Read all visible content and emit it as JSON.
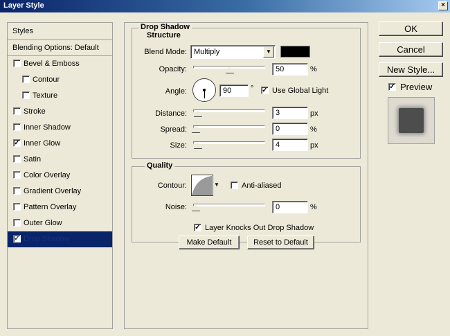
{
  "window": {
    "title": "Layer Style",
    "close_glyph": "×"
  },
  "sidebar": {
    "header": "Styles",
    "blending": "Blending Options: Default",
    "items": [
      {
        "label": "Bevel & Emboss",
        "checked": false,
        "sub": false
      },
      {
        "label": "Contour",
        "checked": false,
        "sub": true
      },
      {
        "label": "Texture",
        "checked": false,
        "sub": true
      },
      {
        "label": "Stroke",
        "checked": false,
        "sub": false
      },
      {
        "label": "Inner Shadow",
        "checked": false,
        "sub": false
      },
      {
        "label": "Inner Glow",
        "checked": true,
        "sub": false
      },
      {
        "label": "Satin",
        "checked": false,
        "sub": false
      },
      {
        "label": "Color Overlay",
        "checked": false,
        "sub": false
      },
      {
        "label": "Gradient Overlay",
        "checked": false,
        "sub": false
      },
      {
        "label": "Pattern Overlay",
        "checked": false,
        "sub": false
      },
      {
        "label": "Outer Glow",
        "checked": false,
        "sub": false
      },
      {
        "label": "Drop Shadow",
        "checked": true,
        "sub": false,
        "selected": true
      }
    ]
  },
  "panel": {
    "title": "Drop Shadow",
    "structure": {
      "legend": "Structure",
      "blend_mode_label": "Blend Mode:",
      "blend_mode_value": "Multiply",
      "shadow_color": "#000000",
      "opacity_label": "Opacity:",
      "opacity_value": "50",
      "opacity_unit": "%",
      "angle_label": "Angle:",
      "angle_value": "90",
      "angle_unit": "°",
      "use_global_light_label": "Use Global Light",
      "use_global_light_checked": true,
      "distance_label": "Distance:",
      "distance_value": "3",
      "distance_unit": "px",
      "spread_label": "Spread:",
      "spread_value": "0",
      "spread_unit": "%",
      "size_label": "Size:",
      "size_value": "4",
      "size_unit": "px"
    },
    "quality": {
      "legend": "Quality",
      "contour_label": "Contour:",
      "anti_aliased_label": "Anti-aliased",
      "anti_aliased_checked": false,
      "noise_label": "Noise:",
      "noise_value": "0",
      "noise_unit": "%"
    },
    "knockout_label": "Layer Knocks Out Drop Shadow",
    "knockout_checked": true,
    "make_default_label": "Make Default",
    "reset_default_label": "Reset to Default"
  },
  "buttons": {
    "ok": "OK",
    "cancel": "Cancel",
    "new_style": "New Style...",
    "preview_label": "Preview",
    "preview_checked": true
  },
  "check_glyph": "✓",
  "dropdown_glyph": "▼"
}
